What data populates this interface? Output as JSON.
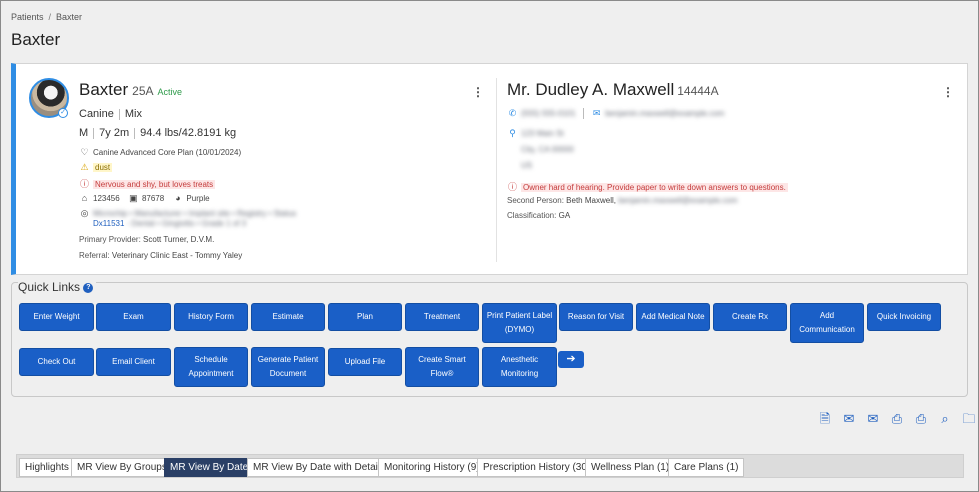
{
  "breadcrumb": {
    "parent": "Patients",
    "separator": "/",
    "current": "Baxter"
  },
  "page_title": "Baxter",
  "patient": {
    "name": "Baxter",
    "id": "25A",
    "status": "Active",
    "species": "Canine",
    "breed": "Mix",
    "sex": "M",
    "age": "7y 2m",
    "weight": "94.4 lbs/42.8191 kg",
    "plan": "Canine Advanced Core Plan (10/01/2024)",
    "warning": "dust",
    "alert": "Nervous and shy, but loves treats",
    "tag1": "123456",
    "tag2": "87678",
    "color": "Purple",
    "blurred_info": "Microchip • Manufacturer • Implant site • Registry • Status",
    "dx": "Dx11531",
    "dx_blurred": "- Dental • Gingivitis • Grade 1 of 3",
    "primary_provider_label": "Primary Provider:",
    "primary_provider": "Scott Turner, D.V.M.",
    "referral_label": "Referral:",
    "referral": "Veterinary Clinic East - Tommy Yaley"
  },
  "owner": {
    "name": "Mr. Dudley A. Maxwell",
    "id": "14444A",
    "phone_blurred": "(555) 555-0101",
    "email_blurred": "benjamin.maxwell@example.com",
    "address_line1_blurred": "123 Main St",
    "address_line2_blurred": "City, CA 00000",
    "address_line3_blurred": "US",
    "alert": "Owner hard of hearing. Provide paper to write down answers to questions.",
    "second_person_label": "Second Person:",
    "second_person": "Beth Maxwell,",
    "second_person_email_blurred": "benjamin.maxwell@example.com",
    "classification_label": "Classification:",
    "classification": "GA"
  },
  "quick_links": {
    "title": "Quick Links",
    "row1": [
      "Enter Weight",
      "Exam",
      "History Form",
      "Estimate",
      "Plan",
      "Treatment",
      "Print Patient Label (DYMO)",
      "Reason for Visit",
      "Add Medical Note",
      "Create Rx",
      "Add Communication",
      "Quick Invoicing"
    ],
    "row2": [
      "Check Out",
      "Email Client",
      "Schedule Appointment",
      "Generate Patient Document",
      "Upload File",
      "Create Smart Flow®",
      "Anesthetic Monitoring"
    ]
  },
  "tabs": [
    "Highlights",
    "MR View By Groups",
    "MR View By Date",
    "MR View By Date with Details",
    "Monitoring History (9)",
    "Prescription History (30)",
    "Wellness Plan (1)",
    "Care Plans (1)"
  ],
  "active_tab": "MR View By Date",
  "colors": {
    "primary_button": "#1a5fc7",
    "accent_border": "#2f8de4",
    "active_tab": "#2a3f66",
    "alert_red": "#c43b3b",
    "status_green": "#2e9a4a"
  }
}
